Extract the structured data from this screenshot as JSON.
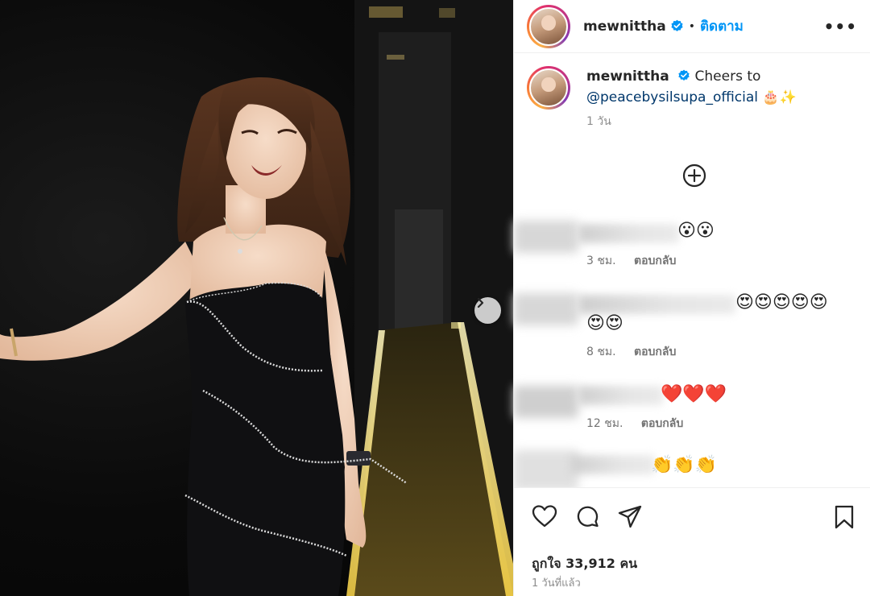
{
  "post": {
    "username": "mewnittha",
    "follow_label": "ติดตาม",
    "more_label": "•••",
    "caption_prefix": "Cheers to",
    "caption_mention": "@peacebysilsupa_official",
    "caption_emojis": "🎂✨",
    "caption_time": "1 วัน"
  },
  "comments": [
    {
      "emojis": "😮😮",
      "time": "3 ชม.",
      "reply_label": "ตอบกลับ"
    },
    {
      "emojis_line1": "😍😍😍😍😍",
      "emojis_line2": "😍😍",
      "time": "8 ชม.",
      "reply_label": "ตอบกลับ"
    },
    {
      "emojis": "❤️❤️❤️",
      "time": "12 ชม.",
      "reply_label": "ตอบกลับ"
    },
    {
      "emojis": "👏👏👏"
    }
  ],
  "footer": {
    "likes_label": "ถูกใจ 33,912 คน",
    "posted_ago": "1 วันที่แล้ว"
  },
  "colors": {
    "accent": "#0095f6",
    "verified": "#0095f6",
    "muted": "#8e8e8e"
  }
}
